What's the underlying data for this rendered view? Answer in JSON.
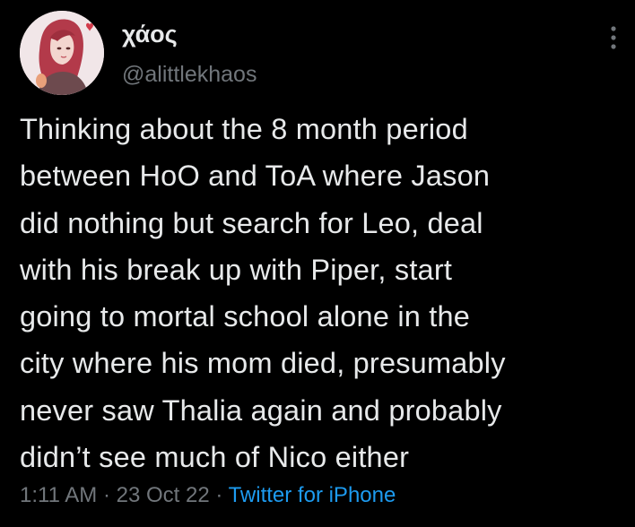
{
  "theme": {
    "background": "#000000",
    "text": "#e7e9ea",
    "secondary": "#71767b",
    "link": "#1d9bf0"
  },
  "user": {
    "display_name": "χάος",
    "handle": "@alittlekhaos",
    "avatar_icon": "avatar-illustration"
  },
  "menu": {
    "icon": "more-options-icon"
  },
  "tweet": {
    "lines": [
      "Thinking about the 8 month period",
      "between HoO and ToA where Jason",
      "did nothing but search for Leo, deal",
      "with his break up with Piper, start",
      "going to mortal school alone in the",
      "city where his mom died, presumably",
      "never saw Thalia again and probably",
      "didn’t see much of Nico either"
    ]
  },
  "meta": {
    "time": "1:11 AM",
    "separator": " · ",
    "date": "23 Oct 22",
    "source": "Twitter for iPhone"
  }
}
